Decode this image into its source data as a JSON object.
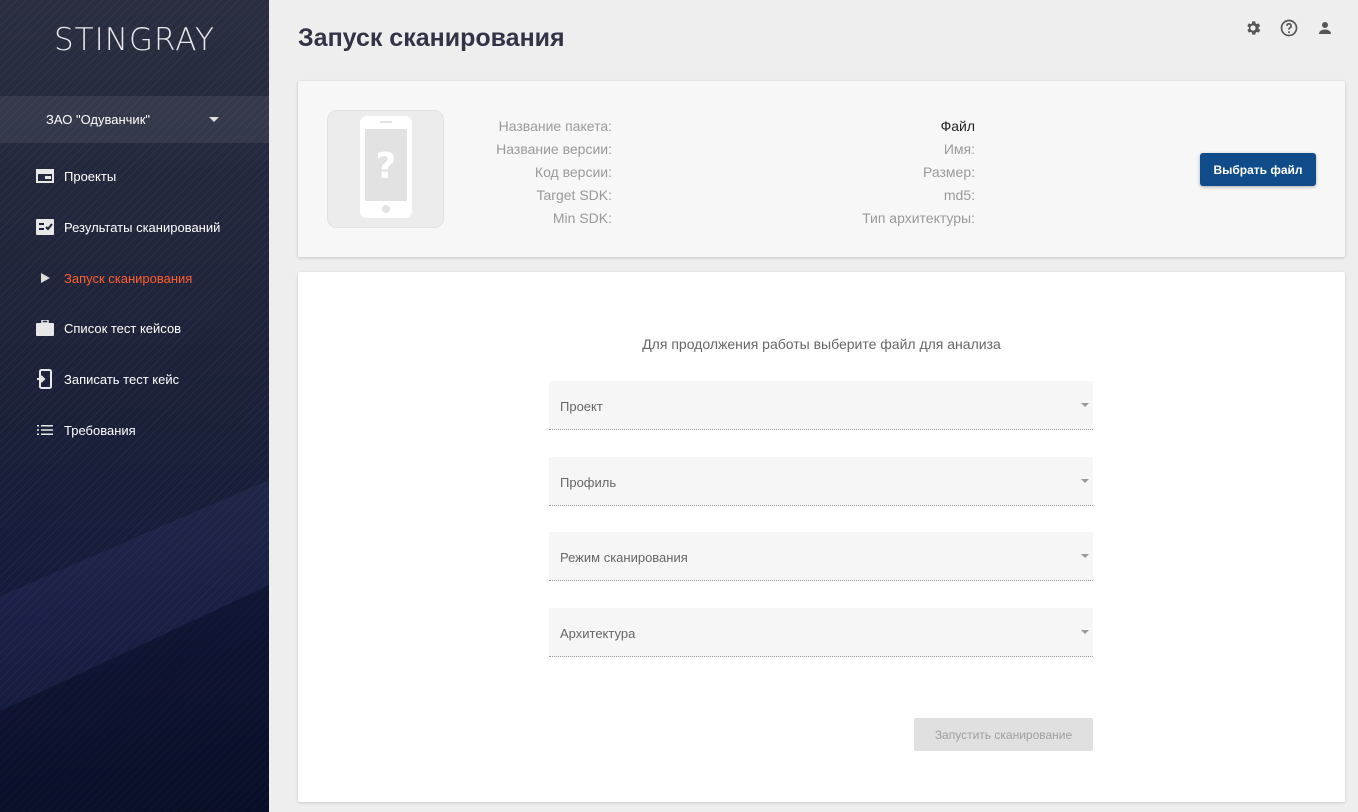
{
  "app": {
    "logo": "STINGRAY"
  },
  "sidebar": {
    "organization": "ЗАО \"Одуванчик\"",
    "items": [
      {
        "label": "Проекты",
        "icon": "projects-icon"
      },
      {
        "label": "Результаты сканирований",
        "icon": "scan-results-icon"
      },
      {
        "label": "Запуск сканирования",
        "icon": "play-icon",
        "active": true
      },
      {
        "label": "Список тест кейсов",
        "icon": "briefcase-icon"
      },
      {
        "label": "Записать тест кейс",
        "icon": "record-device-icon"
      },
      {
        "label": "Требования",
        "icon": "list-icon"
      }
    ]
  },
  "header": {
    "title": "Запуск сканирования",
    "icons": [
      "gear-icon",
      "help-icon",
      "account-icon"
    ]
  },
  "package_info": {
    "labels": [
      "Название пакета:",
      "Название версии:",
      "Код версии:",
      "Target SDK:",
      "Min SDK:"
    ],
    "file_heading": "Файл",
    "file_labels": [
      "Имя:",
      "Размер:",
      "md5:",
      "Тип архитектуры:"
    ],
    "choose_file_label": "Выбрать файл"
  },
  "form": {
    "hint": "Для продолжения работы выберите файл для анализа",
    "selects": {
      "project": "Проект",
      "profile": "Профиль",
      "scan_mode": "Режим сканирования",
      "architecture": "Архитектура"
    },
    "start_label": "Запустить сканирование"
  },
  "colors": {
    "accent_active": "#ff5f2e",
    "primary_button": "#104c8a",
    "sidebar_dark": "#141a3a"
  }
}
